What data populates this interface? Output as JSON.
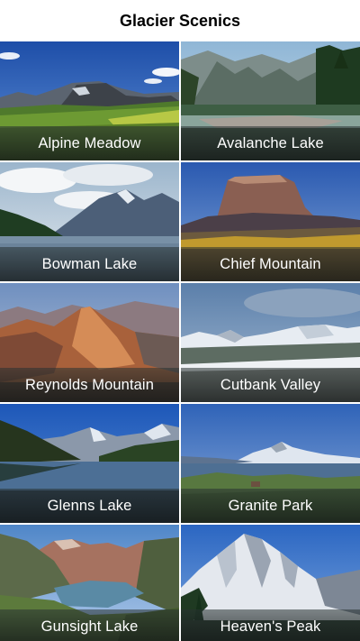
{
  "header": {
    "title": "Glacier Scenics"
  },
  "tiles": [
    {
      "label": "Alpine Meadow"
    },
    {
      "label": "Avalanche Lake"
    },
    {
      "label": "Bowman Lake"
    },
    {
      "label": "Chief Mountain"
    },
    {
      "label": "Reynolds Mountain"
    },
    {
      "label": "Cutbank Valley"
    },
    {
      "label": "Glenns Lake"
    },
    {
      "label": "Granite Park"
    },
    {
      "label": "Gunsight Lake"
    },
    {
      "label": "Heaven's Peak"
    }
  ]
}
